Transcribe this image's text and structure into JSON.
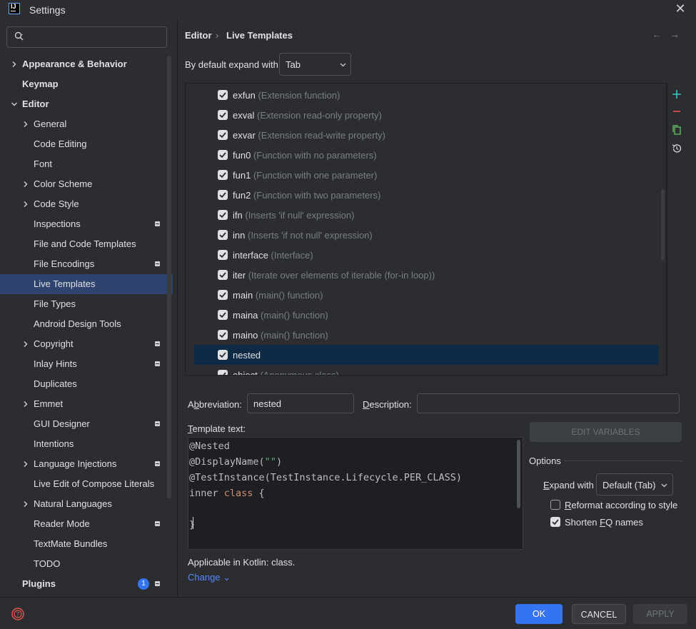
{
  "window": {
    "title": "Settings",
    "app_icon_text": "IJ"
  },
  "search": {
    "placeholder": "",
    "value": ""
  },
  "sidebar": {
    "items": [
      {
        "label": "Appearance & Behavior",
        "level": 0,
        "bold": true,
        "expandable": true,
        "expanded": false
      },
      {
        "label": "Keymap",
        "level": 0,
        "bold": true,
        "expandable": false
      },
      {
        "label": "Editor",
        "level": 0,
        "bold": true,
        "expandable": true,
        "expanded": true
      },
      {
        "label": "General",
        "level": 1,
        "expandable": true
      },
      {
        "label": "Code Editing",
        "level": 1
      },
      {
        "label": "Font",
        "level": 1
      },
      {
        "label": "Color Scheme",
        "level": 1,
        "expandable": true
      },
      {
        "label": "Code Style",
        "level": 1,
        "expandable": true
      },
      {
        "label": "Inspections",
        "level": 1,
        "project": true
      },
      {
        "label": "File and Code Templates",
        "level": 1
      },
      {
        "label": "File Encodings",
        "level": 1,
        "project": true
      },
      {
        "label": "Live Templates",
        "level": 1,
        "selected": true
      },
      {
        "label": "File Types",
        "level": 1
      },
      {
        "label": "Android Design Tools",
        "level": 1
      },
      {
        "label": "Copyright",
        "level": 1,
        "expandable": true,
        "project": true
      },
      {
        "label": "Inlay Hints",
        "level": 1,
        "project": true
      },
      {
        "label": "Duplicates",
        "level": 1
      },
      {
        "label": "Emmet",
        "level": 1,
        "expandable": true
      },
      {
        "label": "GUI Designer",
        "level": 1,
        "project": true
      },
      {
        "label": "Intentions",
        "level": 1
      },
      {
        "label": "Language Injections",
        "level": 1,
        "expandable": true,
        "project": true
      },
      {
        "label": "Live Edit of Compose Literals",
        "level": 1
      },
      {
        "label": "Natural Languages",
        "level": 1,
        "expandable": true
      },
      {
        "label": "Reader Mode",
        "level": 1,
        "project": true
      },
      {
        "label": "TextMate Bundles",
        "level": 1
      },
      {
        "label": "TODO",
        "level": 1
      },
      {
        "label": "Plugins",
        "level": 0,
        "bold": true,
        "badge": "1",
        "project": true
      }
    ]
  },
  "breadcrumb": {
    "parent": "Editor",
    "separator": "›",
    "current": "Live Templates"
  },
  "nav": {
    "back": "←",
    "forward": "→"
  },
  "expand": {
    "label": "By default expand with",
    "value": "Tab"
  },
  "templates": [
    {
      "abbr": "exfun",
      "desc": "(Extension function)",
      "checked": true
    },
    {
      "abbr": "exval",
      "desc": "(Extension read-only property)",
      "checked": true
    },
    {
      "abbr": "exvar",
      "desc": "(Extension read-write property)",
      "checked": true
    },
    {
      "abbr": "fun0",
      "desc": "(Function with no parameters)",
      "checked": true
    },
    {
      "abbr": "fun1",
      "desc": "(Function with one parameter)",
      "checked": true
    },
    {
      "abbr": "fun2",
      "desc": "(Function with two parameters)",
      "checked": true
    },
    {
      "abbr": "ifn",
      "desc": "(Inserts 'if null' expression)",
      "checked": true
    },
    {
      "abbr": "inn",
      "desc": "(Inserts 'if not null' expression)",
      "checked": true
    },
    {
      "abbr": "interface",
      "desc": "(Interface)",
      "checked": true
    },
    {
      "abbr": "iter",
      "desc": "(Iterate over elements of iterable (for-in loop))",
      "checked": true
    },
    {
      "abbr": "main",
      "desc": "(main() function)",
      "checked": true
    },
    {
      "abbr": "maina",
      "desc": "(main() function)",
      "checked": true
    },
    {
      "abbr": "maino",
      "desc": "(main() function)",
      "checked": true
    },
    {
      "abbr": "nested",
      "desc": "",
      "checked": true,
      "selected": true
    },
    {
      "abbr": "object",
      "desc": "(Anonymous class)",
      "checked": true
    }
  ],
  "tools": {
    "add": "+",
    "remove": "−"
  },
  "editor": {
    "abbreviation_label_pre": "A",
    "abbreviation_label_u": "b",
    "abbreviation_label_post": "breviation:",
    "abbreviation_value": "nested",
    "description_label_u": "D",
    "description_label_post": "escription:",
    "description_value": "",
    "template_text_label_u": "T",
    "template_text_label_post": "emplate text:",
    "code": {
      "line1": "@Nested",
      "line2_a": "@DisplayName(",
      "line2_str": "\"\"",
      "line2_b": ")",
      "line3": "@TestInstance(TestInstance.Lifecycle.PER_CLASS)",
      "line4_a": "inner ",
      "line4_kw": "class",
      "line4_b": " {",
      "line5": "",
      "line6": "}"
    },
    "applicable": "Applicable in Kotlin: class.",
    "change_link": "Change ⌄"
  },
  "options": {
    "edit_variables": "EDIT VARIABLES",
    "title": "Options",
    "expand_with_u": "E",
    "expand_with_post": "xpand with",
    "expand_with_value": "Default (Tab)",
    "reformat_u": "R",
    "reformat_post": "eformat according to style",
    "reformat_checked": false,
    "shorten_pre": "Shorten ",
    "shorten_u": "F",
    "shorten_post": "Q names",
    "shorten_checked": true
  },
  "footer": {
    "ok": "OK",
    "cancel": "CANCEL",
    "apply": "APPLY"
  },
  "colors": {
    "accent": "#3574f0",
    "selection": "#2e436e",
    "list_selection": "#0e2a44",
    "link": "#548af7"
  }
}
